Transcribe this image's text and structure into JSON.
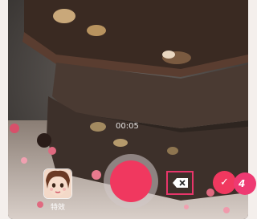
{
  "camera": {
    "timer_text": "00:05",
    "effects_label": "特效",
    "confirm_glyph": "✓",
    "step_number": "4"
  },
  "colors": {
    "accent": "#f0385f",
    "highlight_box": "#e8356a"
  },
  "icons": {
    "effects": "face-avatar-icon",
    "delete": "backspace-icon",
    "confirm": "check-icon"
  }
}
